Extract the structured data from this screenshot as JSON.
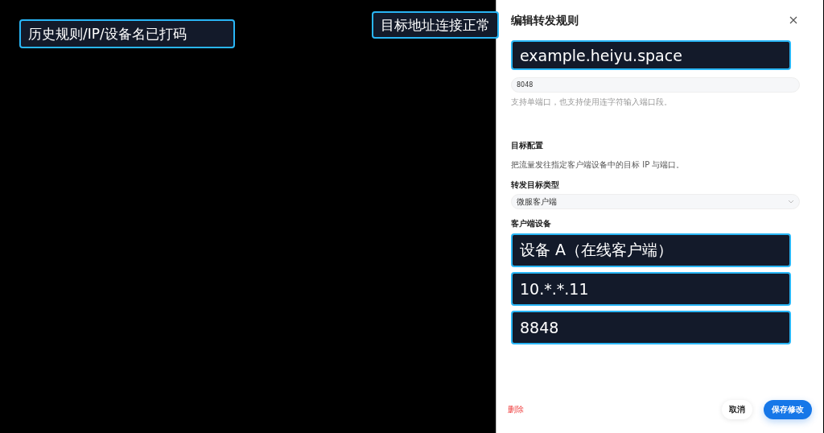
{
  "annotations": [
    {
      "text": "历史规则/IP/设备名已打码"
    },
    {
      "text": "目标地址连接正常"
    }
  ],
  "drawer": {
    "title": "编辑转发规则",
    "masked_host": "example.heiyu.space",
    "port": {
      "value": "8048",
      "hint": "支持单端口，也支持使用连字符输入端口段。"
    },
    "section": {
      "title": "目标配置",
      "description": "把流量发往指定客户端设备中的目标 IP 与端口。"
    },
    "target_type": {
      "label": "转发目标类型",
      "value": "微服客户端"
    },
    "client_device": {
      "label": "客户端设备"
    },
    "masked_values": [
      "设备 A（在线客户端）",
      "10.*.*.11",
      "8848"
    ],
    "footer": {
      "delete": "删除",
      "cancel": "取消",
      "save": "保存修改"
    }
  }
}
